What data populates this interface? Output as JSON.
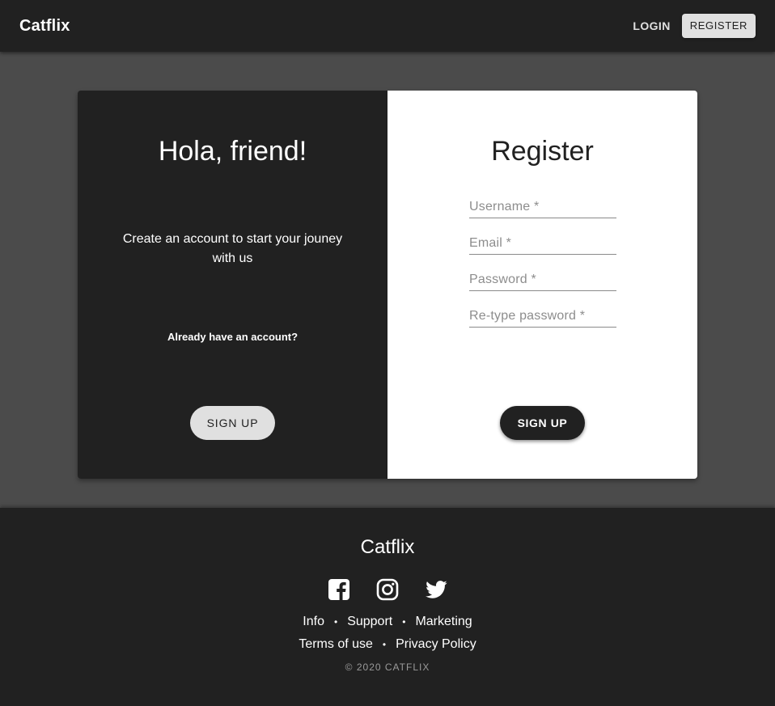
{
  "header": {
    "brand": "Catflix",
    "login_label": "LOGIN",
    "register_label": "REGISTER"
  },
  "welcome_panel": {
    "title": "Hola, friend!",
    "subtitle": "Create an account to start your jouney with us",
    "already_text": "Already have an account?",
    "button_label": "SIGN UP"
  },
  "register_panel": {
    "title": "Register",
    "fields": [
      {
        "placeholder": "Username *",
        "value": ""
      },
      {
        "placeholder": "Email *",
        "value": ""
      },
      {
        "placeholder": "Password *",
        "value": ""
      },
      {
        "placeholder": "Re-type password *",
        "value": ""
      }
    ],
    "button_label": "SIGN UP"
  },
  "footer": {
    "brand": "Catflix",
    "social_icons": [
      "facebook-icon",
      "instagram-icon",
      "twitter-icon"
    ],
    "links_row1": [
      "Info",
      "Support",
      "Marketing"
    ],
    "links_row2": [
      "Terms of use",
      "Privacy Policy"
    ],
    "separator": "•",
    "copyright": "© 2020 CATFLIX"
  },
  "colors": {
    "appbar": "#212121",
    "page_background": "#4b4b4b",
    "dark_panel": "#212121",
    "light_button": "#e0e0e0"
  }
}
